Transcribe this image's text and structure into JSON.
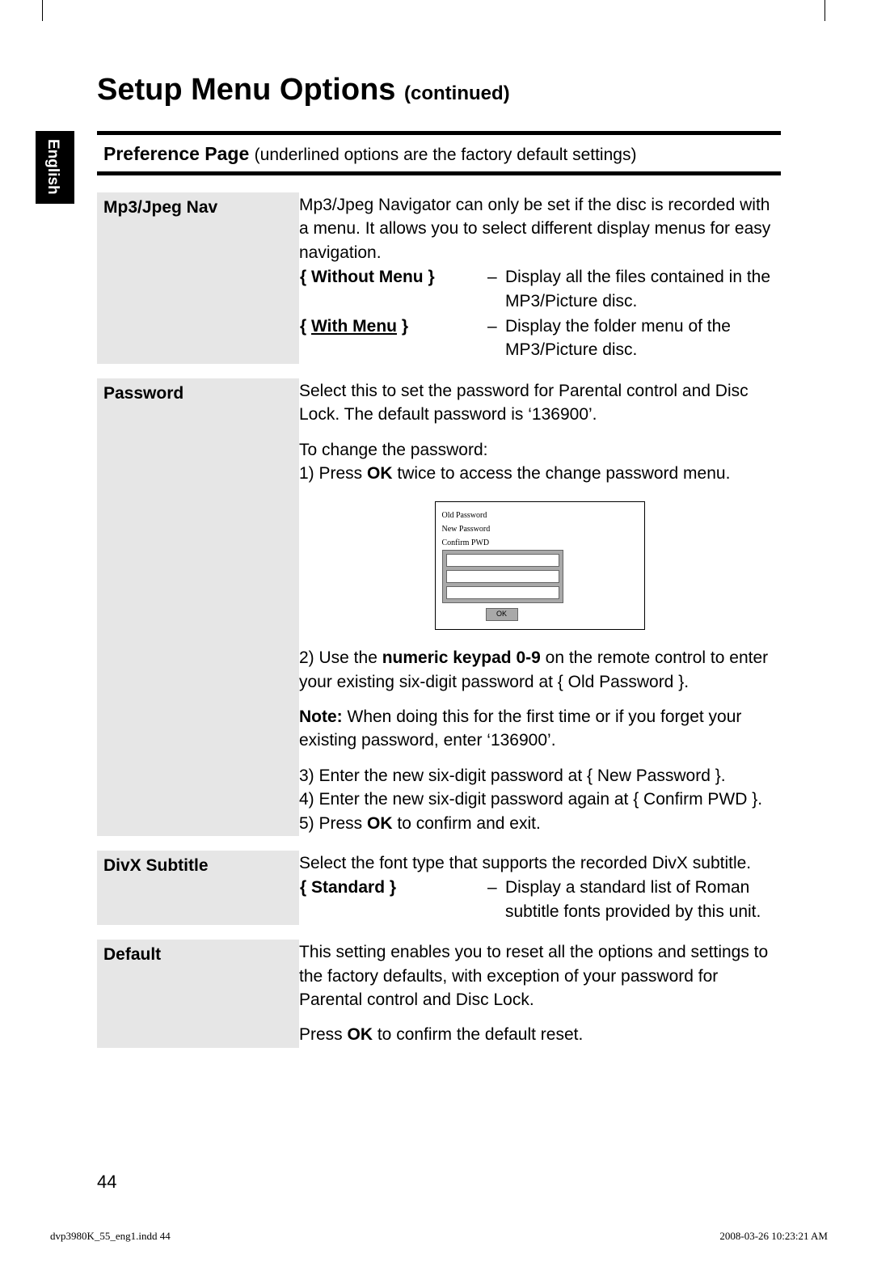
{
  "language_tab": "English",
  "page_title_main": "Setup Menu Options",
  "page_title_cont": "(continued)",
  "section_header_main": "Preference Page",
  "section_header_paren": "(underlined options are the factory default settings)",
  "mp3": {
    "label": "Mp3/Jpeg Nav",
    "intro": "Mp3/Jpeg Navigator can only be set if the disc is recorded with a menu. It allows you to select different display menus for easy navigation.",
    "opt1_label": "{ Without Menu }",
    "opt1_desc": "Display all the files contained in the MP3/Picture disc.",
    "opt2_label": "{ ",
    "opt2_label_u": "With Menu",
    "opt2_label_end": " }",
    "opt2_desc": "Display the folder menu of the MP3/Picture disc."
  },
  "password": {
    "label": "Password",
    "p1": "Select this to set the password for Parental control and Disc Lock. The default password is ‘136900’.",
    "p2": "To change the password:",
    "s1a": "1)  Press ",
    "s1b": "OK",
    "s1c": " twice to access the change password menu.",
    "ui_old": "Old Password",
    "ui_new": "New Password",
    "ui_confirm": "Confirm PWD",
    "ui_ok": "OK",
    "s2a": "2)  Use the ",
    "s2b": "numeric keypad 0-9",
    "s2c": " on the remote control to enter your existing six-digit password at { Old Password }.",
    "note_label": "Note:",
    "note_body": "  When doing this for the first time or if you forget your existing password, enter ‘136900’.",
    "s3": "3)  Enter the new six-digit password at { New Password }.",
    "s4": "4)  Enter the new six-digit password again at { Confirm PWD }.",
    "s5a": "5)  Press ",
    "s5b": "OK",
    "s5c": " to confirm and exit."
  },
  "divx": {
    "label": "DivX Subtitle",
    "intro": "Select the font type that supports the recorded DivX subtitle.",
    "opt_label": "{ Standard }",
    "opt_desc": "Display a standard list of Roman subtitle fonts provided by this unit."
  },
  "def": {
    "label": "Default",
    "p1": "This setting enables you to reset all the options and settings to the factory defaults, with exception of your password for Parental control and Disc Lock.",
    "p2a": "Press ",
    "p2b": "OK",
    "p2c": " to confirm the default reset."
  },
  "page_number": "44",
  "footer_left": "dvp3980K_55_eng1.indd   44",
  "footer_right": "2008-03-26   10:23:21 AM"
}
